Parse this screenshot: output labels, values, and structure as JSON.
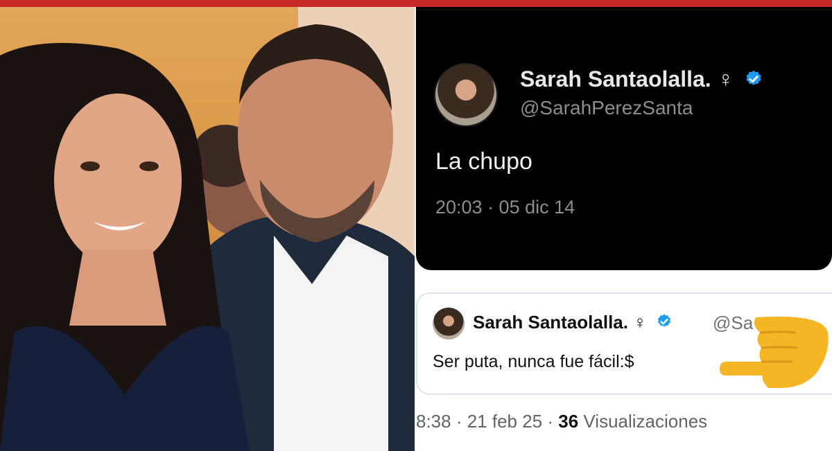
{
  "main_tweet": {
    "display_name": "Sarah Santaolalla.",
    "name_symbol": "♀",
    "handle": "@SarahPerezSanta",
    "text": "La chupo",
    "timestamp": "20:03 · 05 dic 14"
  },
  "quoted_tweet": {
    "display_name": "Sarah Santaolalla.",
    "name_symbol": "♀",
    "handle_partial": "@Sa",
    "text": "Ser puta, nunca fue fácil:$"
  },
  "footer": {
    "timestamp": "8:38 · 21 feb 25 ·",
    "views_count": "36",
    "views_label": "Visualizaciones"
  },
  "colors": {
    "top_bar": "#c62828",
    "verified_badge": "#1d9bf0",
    "dark_card": "#000000",
    "pointing_hand": "#f4b625"
  },
  "icons": {
    "verified": "verified-badge-icon",
    "pointing_hand": "pointing-hand-emoji"
  }
}
